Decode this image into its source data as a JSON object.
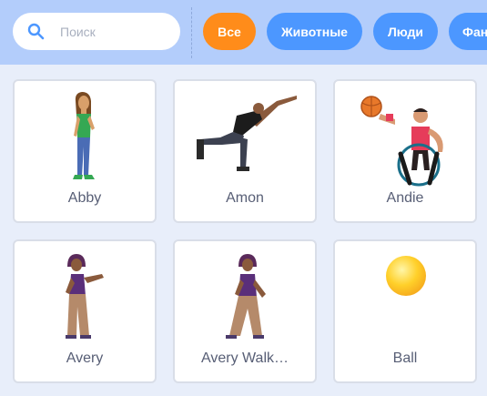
{
  "search": {
    "placeholder": "Поиск",
    "value": ""
  },
  "filters": [
    {
      "label": "Все",
      "active": true
    },
    {
      "label": "Животные",
      "active": false
    },
    {
      "label": "Люди",
      "active": false
    },
    {
      "label": "Фантазия",
      "active": false
    }
  ],
  "sprites": [
    {
      "name": "Abby"
    },
    {
      "name": "Amon"
    },
    {
      "name": "Andie"
    },
    {
      "name": "Avery"
    },
    {
      "name": "Avery Walk…"
    },
    {
      "name": "Ball"
    }
  ]
}
